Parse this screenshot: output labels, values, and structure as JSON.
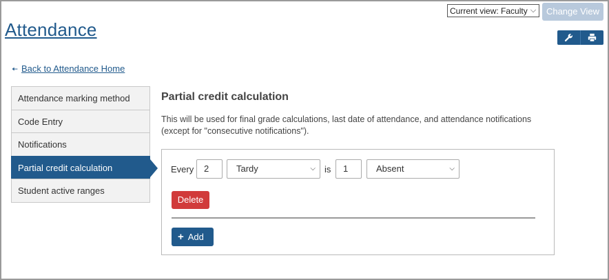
{
  "header": {
    "view_select_value": "Current view: Faculty",
    "change_view_label": "Change View",
    "page_title": "Attendance",
    "tool_icons": [
      "wrench-icon",
      "print-icon"
    ]
  },
  "back_link": {
    "label": "Back to Attendance Home"
  },
  "sidebar": {
    "items": [
      {
        "label": "Attendance marking method",
        "active": false
      },
      {
        "label": "Code Entry",
        "active": false
      },
      {
        "label": "Notifications",
        "active": false
      },
      {
        "label": "Partial credit calculation",
        "active": true
      },
      {
        "label": "Student active ranges",
        "active": false
      }
    ]
  },
  "main": {
    "title": "Partial credit calculation",
    "description": "This will be used for final grade calculations, last date of attendance, and attendance notifications (except for \"consecutive notifications\").",
    "rule": {
      "every_label": "Every",
      "count_value": "2",
      "source_code": "Tardy",
      "is_label": "is",
      "result_count_value": "1",
      "result_code": "Absent"
    },
    "delete_label": "Delete",
    "add_label": "Add"
  },
  "colors": {
    "primary": "#215a8c",
    "danger": "#d13b3b",
    "disabled": "#b8c9dc"
  }
}
